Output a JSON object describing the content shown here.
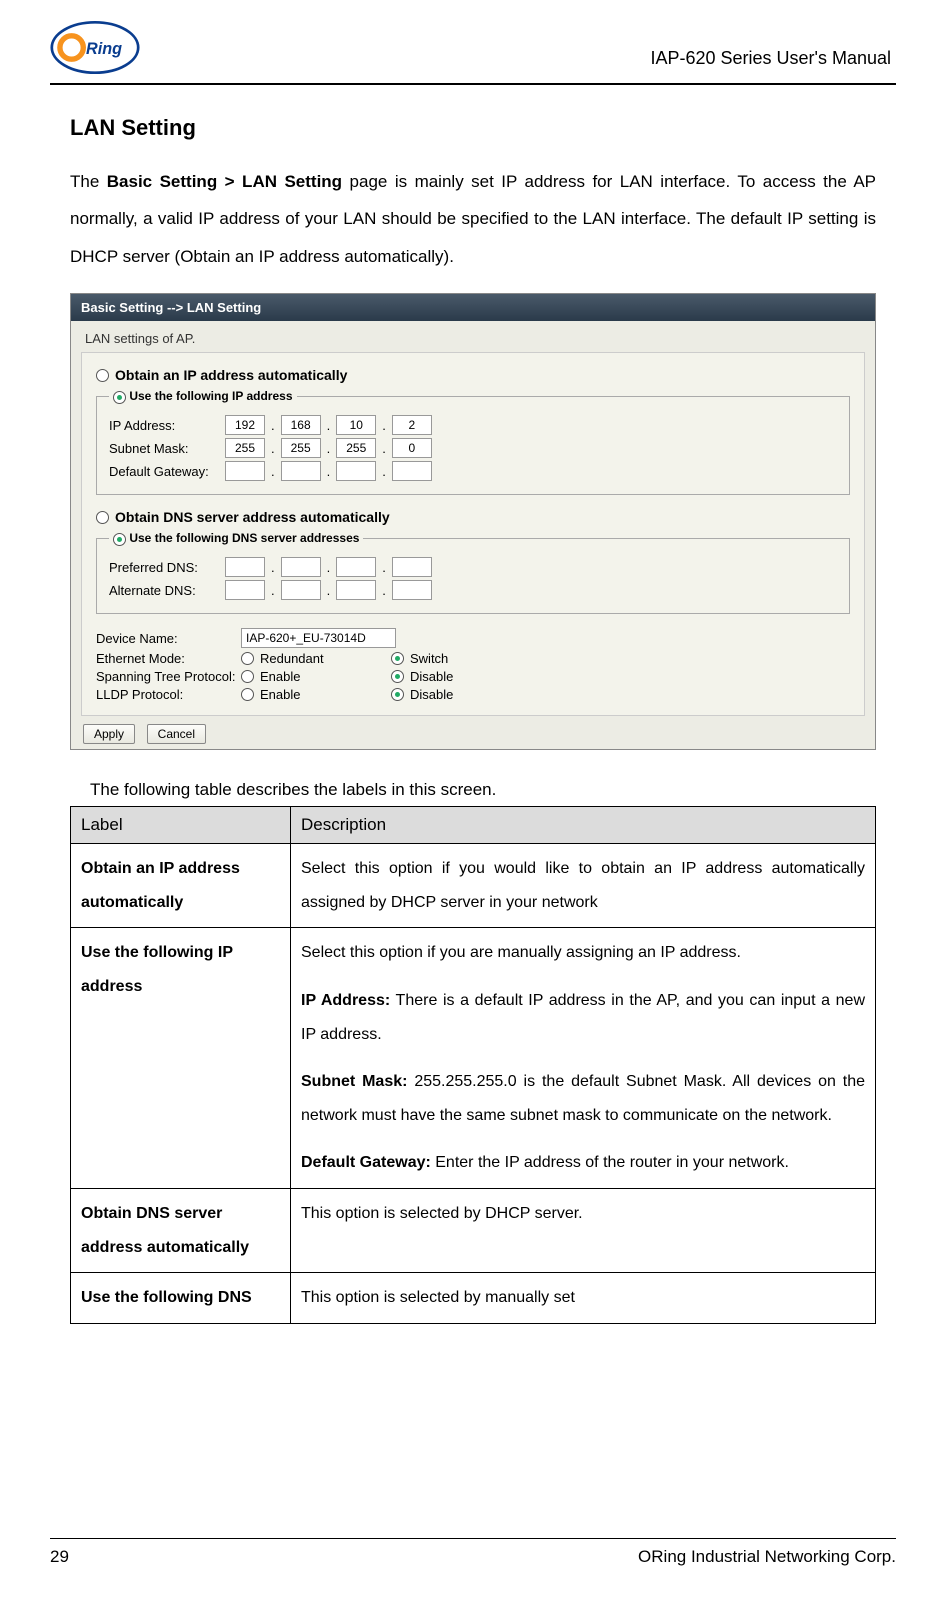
{
  "header": {
    "doc_title": "IAP-620 Series User's Manual"
  },
  "section": {
    "title": "LAN Setting",
    "intro_prefix": "The ",
    "intro_bold": "Basic Setting > LAN Setting",
    "intro_rest": " page is mainly set IP address for LAN interface.  To access the AP normally, a valid IP address of your LAN should be specified to the LAN interface.  The default IP setting is DHCP server (Obtain an IP address automatically)."
  },
  "screenshot": {
    "breadcrumb": "Basic Setting --> LAN Setting",
    "subtitle": "LAN settings of AP.",
    "obtain_ip": "Obtain an IP address automatically",
    "use_ip_legend": "Use the following IP address",
    "ip_label": "IP Address:",
    "subnet_label": "Subnet Mask:",
    "gateway_label": "Default Gateway:",
    "ip": [
      "192",
      "168",
      "10",
      "2"
    ],
    "subnet": [
      "255",
      "255",
      "255",
      "0"
    ],
    "gateway": [
      "",
      "",
      "",
      ""
    ],
    "obtain_dns": "Obtain DNS server address automatically",
    "use_dns_legend": "Use the following DNS server addresses",
    "pref_dns_label": "Preferred DNS:",
    "alt_dns_label": "Alternate DNS:",
    "pref_dns": [
      "",
      "",
      "",
      ""
    ],
    "alt_dns": [
      "",
      "",
      "",
      ""
    ],
    "device_name_label": "Device Name:",
    "device_name": "IAP-620+_EU-73014D",
    "eth_mode_label": "Ethernet Mode:",
    "eth_redundant": "Redundant",
    "eth_switch": "Switch",
    "stp_label": "Spanning Tree Protocol:",
    "enable": "Enable",
    "disable": "Disable",
    "lldp_label": "LLDP Protocol:",
    "apply": "Apply",
    "cancel": "Cancel"
  },
  "caption": "The following table describes the labels in this screen.",
  "table": {
    "head_label": "Label",
    "head_desc": "Description",
    "rows": [
      {
        "label": "Obtain an IP address automatically",
        "desc": "Select this option if you would like to obtain an IP address automatically assigned by DHCP server in your network"
      },
      {
        "label": "Use the following IP address",
        "p1": "Select this option if you are manually assigning an IP address.",
        "p2_b": "IP Address:",
        "p2_t": " There is a default IP address in the AP, and you can input a new IP address.",
        "p3_b": "Subnet Mask:",
        "p3_t": " 255.255.255.0 is the default Subnet Mask.  All devices on the network must have the same subnet mask to communicate on the network.",
        "p4_b": "Default Gateway:",
        "p4_t": " Enter the IP address of the router in your network."
      },
      {
        "label": "Obtain DNS server address automatically",
        "desc": "This option is selected by DHCP server."
      },
      {
        "label": "Use the following DNS",
        "desc": "This option is selected by manually set"
      }
    ]
  },
  "footer": {
    "page": "29",
    "company": "ORing Industrial Networking Corp."
  }
}
